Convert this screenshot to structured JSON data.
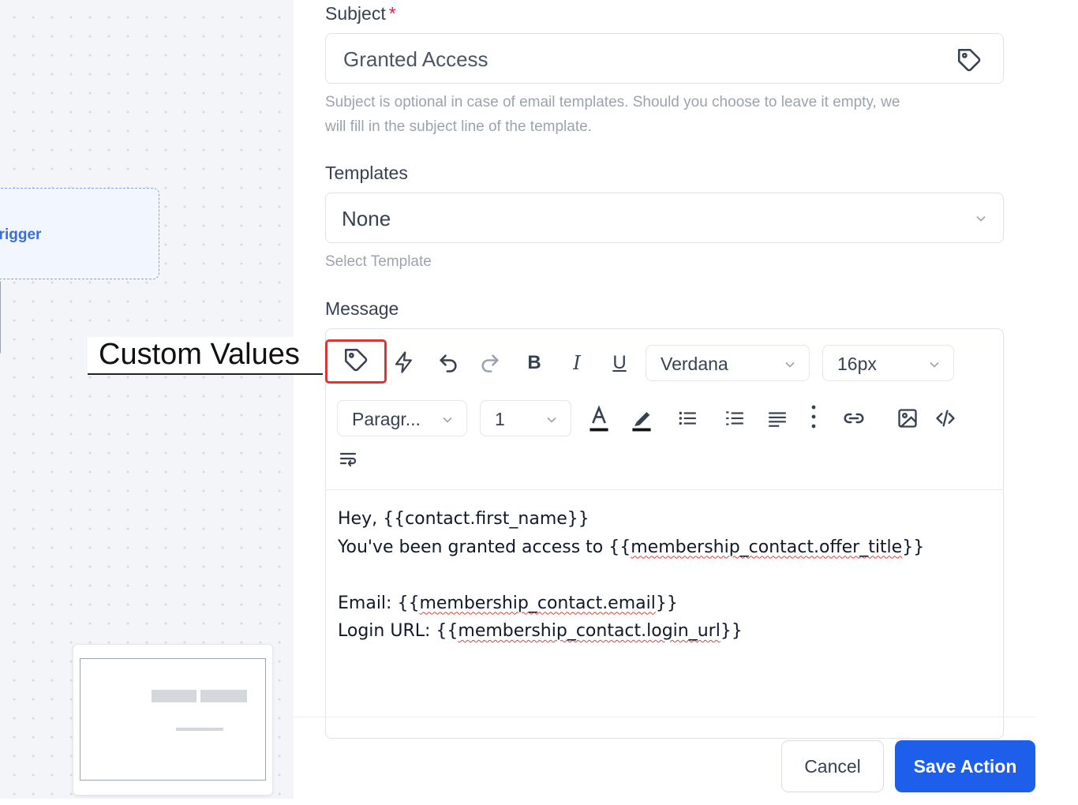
{
  "canvas": {
    "trigger_label": "Trigger",
    "callout_label": "Custom Values"
  },
  "form": {
    "subject": {
      "label": "Subject",
      "required_marker": "*",
      "value": "Granted Access",
      "helper_line1": "Subject is optional in case of email templates. Should you choose to leave it empty, we",
      "helper_line2": "will fill in the subject line of the template."
    },
    "templates": {
      "label": "Templates",
      "selected": "None",
      "helper": "Select Template"
    },
    "message": {
      "label": "Message",
      "toolbar": {
        "font_family": "Verdana",
        "font_size": "16px",
        "block_format": "Paragr...",
        "line_height": "1",
        "icons": [
          "tag-icon",
          "bolt-icon",
          "undo-icon",
          "redo-icon",
          "bold-icon",
          "italic-icon",
          "underline-icon",
          "text-color-icon",
          "highlight-icon",
          "bullet-list-icon",
          "numbered-list-icon",
          "align-icon",
          "more-vertical-icon",
          "link-icon",
          "image-icon",
          "code-icon",
          "text-wrap-icon"
        ]
      },
      "body": {
        "line1": "Hey, {{contact.first_name}}",
        "line2_prefix": "You've been granted access to {{",
        "line2_var": "membership_contact.offer_title",
        "line2_suffix": "}}",
        "line3_prefix": "Email: {{",
        "line3_var": "membership_contact.email",
        "line3_suffix": "}}",
        "line4_prefix": "Login URL: {{",
        "line4_var": "membership_contact.login_url",
        "line4_suffix": "}}"
      }
    }
  },
  "footer": {
    "cancel_label": "Cancel",
    "save_label": "Save Action"
  },
  "colors": {
    "primary": "#1d5fea",
    "highlight_border": "#e03434",
    "required": "#e11d48"
  }
}
